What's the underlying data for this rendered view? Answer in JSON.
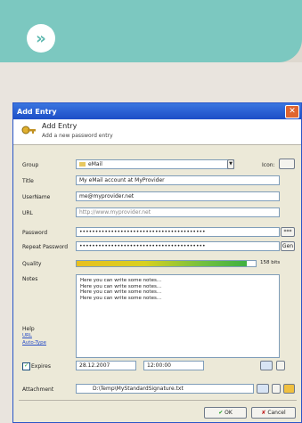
{
  "banner": {
    "icon": "double-chevron-right-icon",
    "glyph": "»"
  },
  "window": {
    "title": "Add Entry"
  },
  "header": {
    "title": "Add Entry",
    "subtitle": "Add a new password entry"
  },
  "form": {
    "group_label": "Group",
    "group_value": "eMail",
    "icon_label": "Icon:",
    "title_label": "Title",
    "title_value": "My eMail account at MyProvider",
    "username_label": "UserName",
    "username_value": "me@myprovider.net",
    "url_label": "URL",
    "url_value": "http://www.myprovider.net",
    "password_label": "Password",
    "password_value": "••••••••••••••••••••••••••••••••••••••••",
    "repeat_label": "Repeat Password",
    "repeat_value": "••••••••••••••••••••••••••••••••••••••••",
    "quality_label": "Quality",
    "quality_text": "158 bits",
    "quality_fraction": 0.95,
    "notes_label": "Notes",
    "notes_lines": [
      "Here you can write some notes...",
      "Here you can write some notes...",
      "Here you can write some notes...",
      "Here you can write some notes..."
    ],
    "help_label": "Help",
    "help_link1": "URL",
    "help_link2": "Auto-Type",
    "expires_label": "Expires",
    "expires_date": "28.12.2007",
    "expires_time": "12:00:00",
    "attachment_label": "Attachment",
    "attachment_value": "D:\\Temp\\MyStandardSignature.txt",
    "show_password_button": "***",
    "gen_button": "Gen",
    "ok_button": "OK",
    "cancel_button": "Cancel"
  },
  "colors": {
    "accent": "#7cc8c0",
    "titlebar": "#1d4ec7"
  }
}
